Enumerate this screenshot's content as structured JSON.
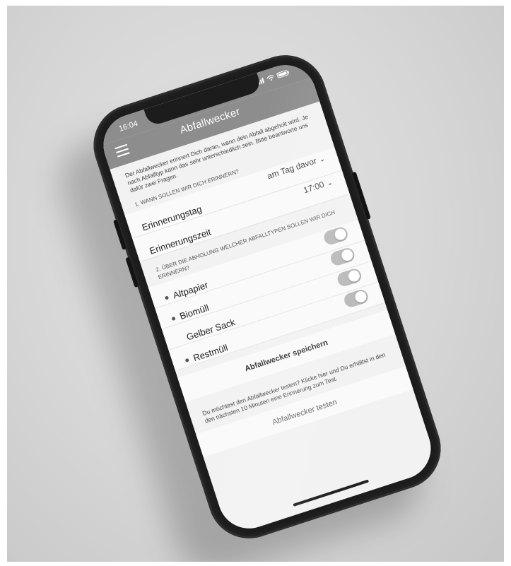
{
  "status_bar": {
    "time": "16:04",
    "icons": [
      "signal-icon",
      "wifi-icon",
      "battery-icon"
    ]
  },
  "nav": {
    "title": "Abfallwecker",
    "menu_icon": "hamburger-menu-icon"
  },
  "intro_text": "Der Abfallwecker erinnert Dich daran, wann dein Abfall abgeholt wird. Je nach Abfalltyp kann das sehr unterschiedlich sein. Bitte beantworte uns dafür zwei Fragen.",
  "section1": {
    "heading": "1. WANN SOLLEN WIR DICH ERINNERN?",
    "rows": [
      {
        "label": "Erinnerungstag",
        "value": "am Tag davor"
      },
      {
        "label": "Erinnerungszeit",
        "value": "17:00"
      }
    ]
  },
  "section2": {
    "heading": "2. ÜBER DIE ABHOLUNG WELCHER ABFALLTYPEN SOLLEN WIR DICH ERINNERN?",
    "types": [
      {
        "label": "Altpapier",
        "bullet": true,
        "enabled": true
      },
      {
        "label": "Biomüll",
        "bullet": true,
        "enabled": true
      },
      {
        "label": "Gelber Sack",
        "bullet": false,
        "enabled": true
      },
      {
        "label": "Restmüll",
        "bullet": true,
        "enabled": true
      }
    ]
  },
  "save_button": "Abfallwecker speichern",
  "test_text": "Du möchtest den Abfallwecker testen? Klicke hier und Du erhältst in den den nächsten 10 Minuten eine Erinnerung zum Test.",
  "test_button": "Abfallwecker testen",
  "colors": {
    "header": "#8d8d8d",
    "screen_bg": "#f2f2f2",
    "case": "#1c1c1c"
  }
}
